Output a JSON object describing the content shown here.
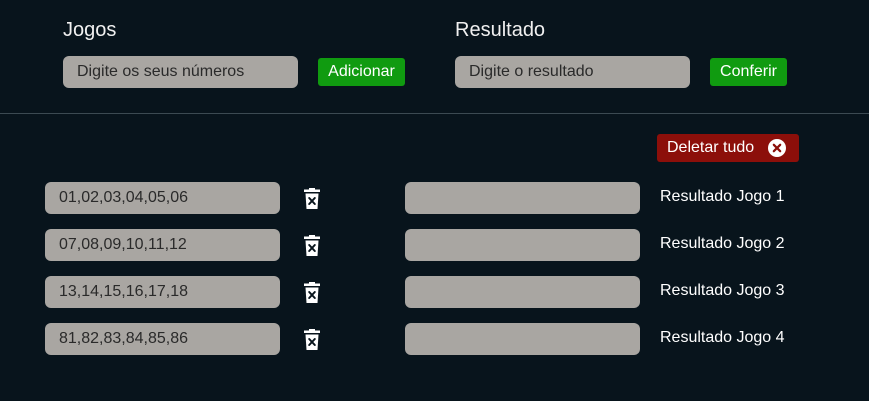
{
  "jogos": {
    "title": "Jogos",
    "input_placeholder": "Digite os seus números",
    "add_button": "Adicionar"
  },
  "resultado": {
    "title": "Resultado",
    "input_placeholder": "Digite o resultado",
    "check_button": "Conferir"
  },
  "delete_all": {
    "label": "Deletar tudo",
    "icon": "close-circle-icon"
  },
  "rows": [
    {
      "numbers": "01,02,03,04,05,06",
      "result": "",
      "label": "Resultado Jogo 1"
    },
    {
      "numbers": "07,08,09,10,11,12",
      "result": "",
      "label": "Resultado Jogo 2"
    },
    {
      "numbers": "13,14,15,16,17,18",
      "result": "",
      "label": "Resultado Jogo 3"
    },
    {
      "numbers": "81,82,83,84,85,86",
      "result": "",
      "label": "Resultado Jogo 4"
    }
  ],
  "colors": {
    "background": "#08141c",
    "input_bg": "#a9a6a2",
    "green_button": "#109b10",
    "red_button": "#8c0f0a"
  }
}
